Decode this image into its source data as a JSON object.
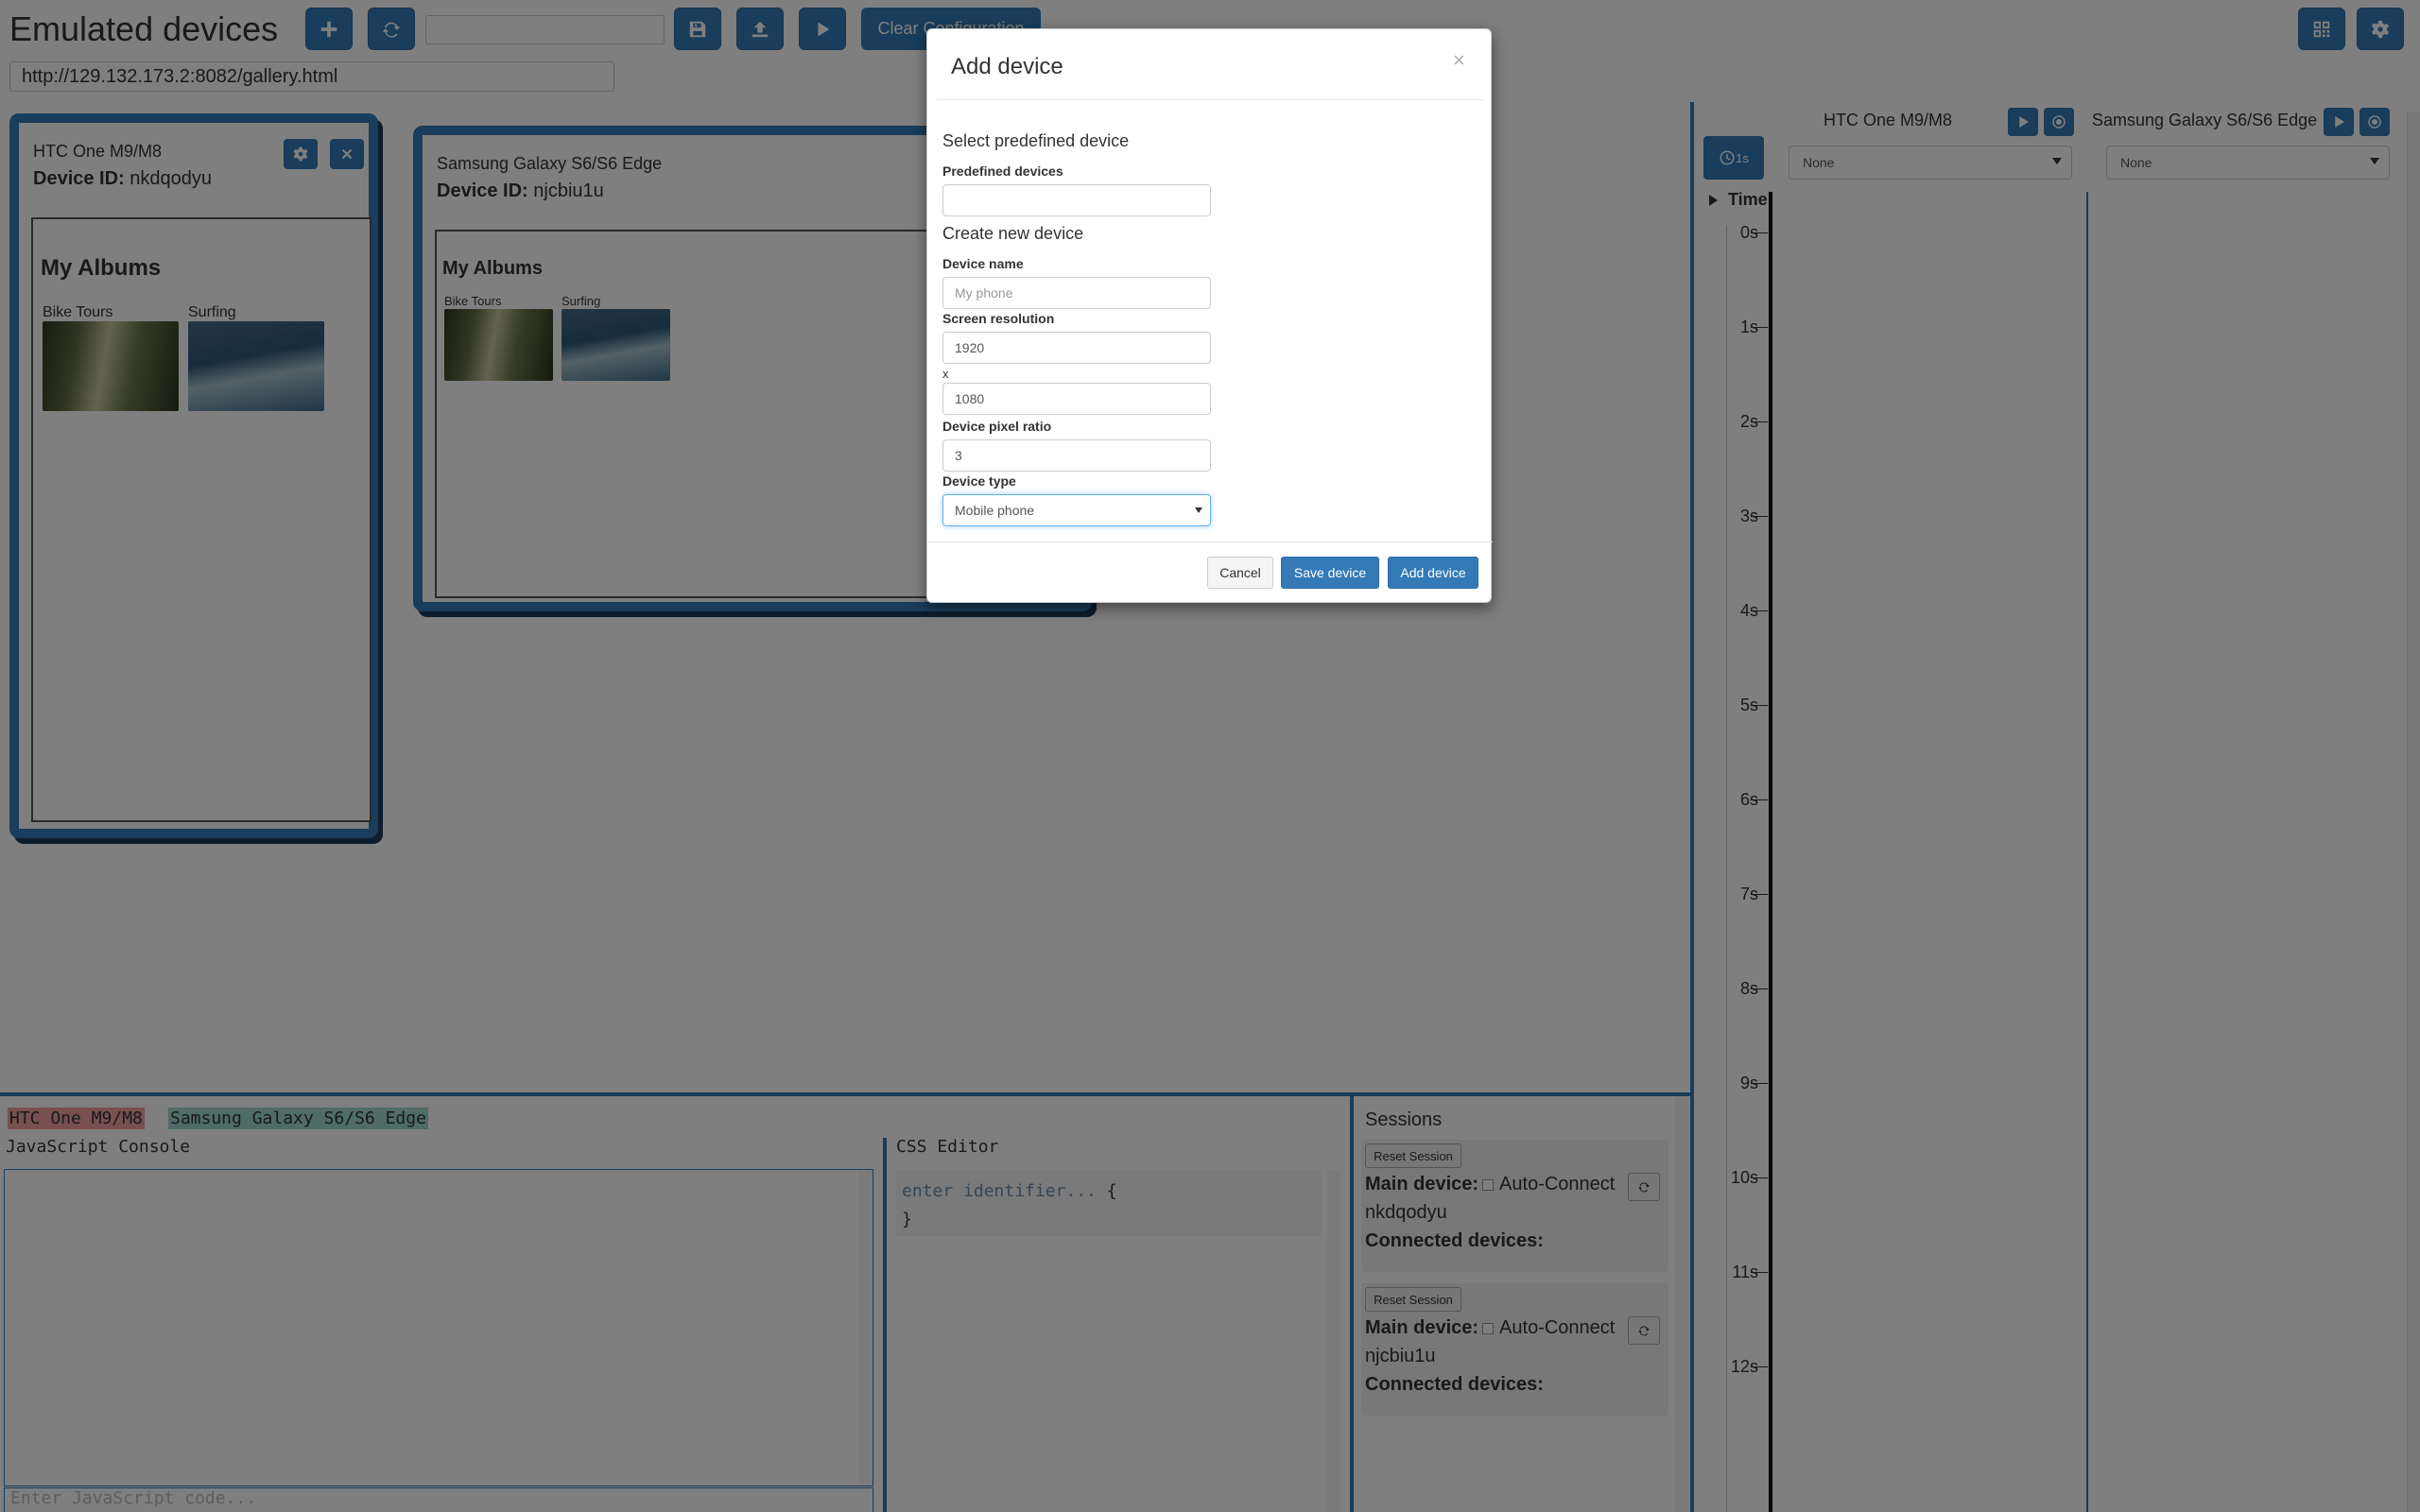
{
  "header": {
    "title": "Emulated devices",
    "url": "http://129.132.173.2:8082/gallery.html",
    "clear_label": "Clear Configuration",
    "name_input_value": ""
  },
  "devices": [
    {
      "name": "HTC One M9/M8",
      "id_label": "Device ID:",
      "id": "nkdqodyu",
      "albums_title": "My Albums",
      "albums": [
        "Bike Tours",
        "Surfing"
      ]
    },
    {
      "name": "Samsung Galaxy S6/S6 Edge",
      "id_label": "Device ID:",
      "id": "njcbiu1u",
      "albums_title": "My Albums",
      "albums": [
        "Bike Tours",
        "Surfing"
      ]
    }
  ],
  "timeline": {
    "col1_title": "HTC One M9/M8",
    "col2_title": "Samsung Galaxy S6/S6 Edge",
    "select_value": "None",
    "time_header": "Time",
    "clock_label": "1s",
    "ticks": [
      "0s",
      "1s",
      "2s",
      "3s",
      "4s",
      "5s",
      "6s",
      "7s",
      "8s",
      "9s",
      "10s",
      "11s",
      "12s"
    ]
  },
  "bottom": {
    "device_tags": [
      "HTC One M9/M8",
      "Samsung Galaxy S6/S6 Edge"
    ],
    "js_console_title": "JavaScript Console",
    "js_placeholder": "Enter JavaScript code...",
    "css_editor_title": "CSS Editor",
    "css_line1": "enter identifier...",
    "css_brace_open": " {",
    "css_brace_close": "}"
  },
  "sessions": {
    "title": "Sessions",
    "items": [
      {
        "reset_label": "Reset Session",
        "main_label": "Main device:",
        "auto_label": "Auto-Connect",
        "device_id": "nkdqodyu",
        "connected_label": "Connected devices:"
      },
      {
        "reset_label": "Reset Session",
        "main_label": "Main device:",
        "auto_label": "Auto-Connect",
        "device_id": "njcbiu1u",
        "connected_label": "Connected devices:"
      }
    ]
  },
  "modal": {
    "title": "Add device",
    "close": "×",
    "section1": "Select predefined device",
    "predefined_label": "Predefined devices",
    "predefined_value": "",
    "section2": "Create new device",
    "name_label": "Device name",
    "name_placeholder": "My phone",
    "resolution_label": "Screen resolution",
    "res_width": "1920",
    "res_x": "x",
    "res_height": "1080",
    "ratio_label": "Device pixel ratio",
    "ratio": "3",
    "type_label": "Device type",
    "type_value": "Mobile phone",
    "cancel": "Cancel",
    "save": "Save device",
    "add": "Add device"
  }
}
